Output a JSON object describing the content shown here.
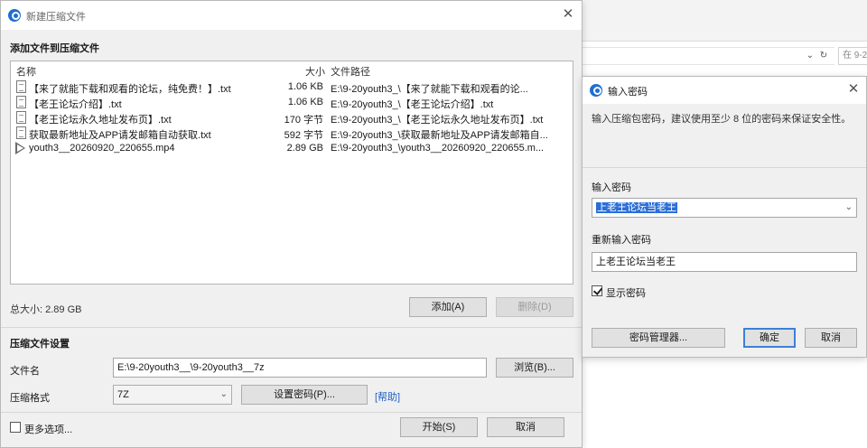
{
  "background": {
    "search_placeholder": "在 9-2",
    "refresh_icon": "refresh-icon",
    "dropdown_icon": "chevron-down-icon"
  },
  "compress_dialog": {
    "title": "新建压缩文件",
    "add_section_title": "添加文件到压缩文件",
    "columns": {
      "name": "名称",
      "size": "大小",
      "path": "文件路径"
    },
    "files": [
      {
        "name": "【来了就能下载和观看的论坛，纯免费！】.txt",
        "size": "1.06 KB",
        "path": "E:\\9-20youth3_\\【来了就能下载和观看的论...",
        "icon": "text-file-icon"
      },
      {
        "name": "【老王论坛介绍】.txt",
        "size": "1.06 KB",
        "path": "E:\\9-20youth3_\\【老王论坛介绍】.txt",
        "icon": "text-file-icon"
      },
      {
        "name": "【老王论坛永久地址发布页】.txt",
        "size": "170 字节",
        "path": "E:\\9-20youth3_\\【老王论坛永久地址发布页】.txt",
        "icon": "text-file-icon"
      },
      {
        "name": "获取最新地址及APP请发邮箱自动获取.txt",
        "size": "592 字节",
        "path": "E:\\9-20youth3_\\获取最新地址及APP请发邮箱自...",
        "icon": "text-file-icon"
      },
      {
        "name": "youth3__20260920_220655.mp4",
        "size": "2.89 GB",
        "path": "E:\\9-20youth3_\\youth3__20260920_220655.m...",
        "icon": "video-file-icon"
      }
    ],
    "total_size": "总大小: 2.89 GB",
    "add_button": "添加(A)",
    "remove_button": "删除(D)",
    "settings_title": "压缩文件设置",
    "filename_label": "文件名",
    "filename_value": "E:\\9-20youth3__\\9-20youth3__7z",
    "browse_button": "浏览(B)...",
    "format_label": "压缩格式",
    "format_value": "7Z",
    "set_password_button": "设置密码(P)...",
    "help_link": "[帮助]",
    "more_options": "更多选项...",
    "start_button": "开始(S)",
    "cancel_button": "取消"
  },
  "password_dialog": {
    "title": "输入密码",
    "note": "输入压缩包密码，建议使用至少 8 位的密码来保证安全性。",
    "password_label": "输入密码",
    "password_value": "上老王论坛当老王",
    "reenter_label": "重新输入密码",
    "reenter_value": "上老王论坛当老王",
    "show_password_label": "显示密码",
    "show_password_checked": true,
    "manager_button": "密码管理器...",
    "ok_button": "确定",
    "cancel_button": "取消"
  }
}
